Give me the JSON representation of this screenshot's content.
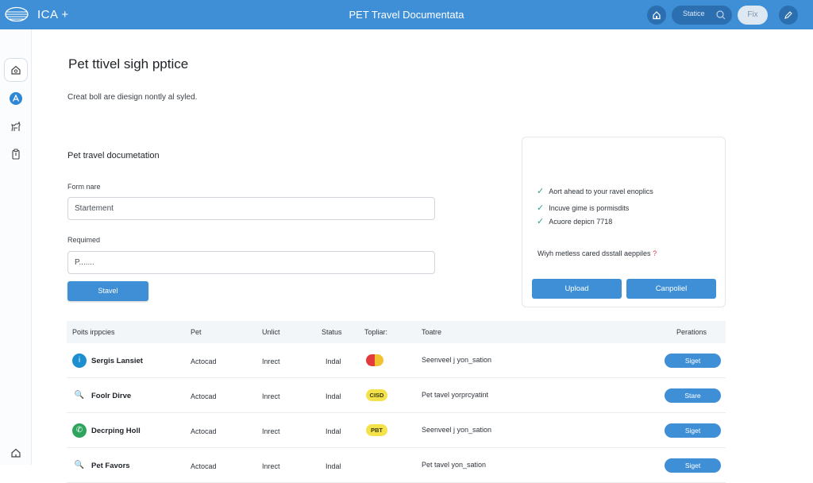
{
  "topbar": {
    "brand": "ICA +",
    "title": "PET Travel Documentata",
    "search_label": "Statice",
    "fix_label": "Fix"
  },
  "page": {
    "title": "Pet ttivel sigh pptice",
    "subtitle": "Creat boll are diesign nontly al syled.",
    "section_title": "Pet travel documetation"
  },
  "form": {
    "field1_label": "Form nare",
    "field1_value": "Startement",
    "field2_label": "Requimed",
    "field2_value": "P.......",
    "save_label": "Stavel"
  },
  "panel": {
    "checks": [
      "Aort ahead to your ravel enoplics",
      "Incuve gime is pormisdits",
      "Acuore depicn 7718"
    ],
    "question": "Wiyh metless cared dsstall aeppiles",
    "question_mark": "?",
    "upload_label": "Upload",
    "cancel_label": "Canpoliel"
  },
  "table": {
    "headers": [
      "Poits irppcies",
      "Pet",
      "Unlict",
      "Status",
      "Topliar:",
      "Toatre",
      "Perations"
    ],
    "rows": [
      {
        "name": "Sergis Lansiet",
        "pet": "Actocad",
        "unlict": "Inrect",
        "status": "Indal",
        "badge": "",
        "toatre": "Seenveel j yon_sation",
        "action": "Siget",
        "icon_color": "#1d8fd0",
        "icon_glyph": "i"
      },
      {
        "name": "Foolr Dirve",
        "pet": "Actocad",
        "unlict": "Inrect",
        "status": "Indal",
        "badge": "CISD",
        "toatre": "Pet tavel yorprcyatint",
        "action": "Stare",
        "icon_color": "#ffffff",
        "icon_glyph": "🔍"
      },
      {
        "name": "Decrping Holl",
        "pet": "Actocad",
        "unlict": "Inrect",
        "status": "Indal",
        "badge": "PBT",
        "toatre": "Seenveel j yon_sation",
        "action": "Siget",
        "icon_color": "#2fa45c",
        "icon_glyph": "✆"
      },
      {
        "name": "Pet Favors",
        "pet": "Actocad",
        "unlict": "Inrect",
        "status": "Indal",
        "badge": "",
        "toatre": "Pet tavel yon_sation",
        "action": "Siget",
        "icon_color": "#ffffff",
        "icon_glyph": "🔍"
      }
    ]
  },
  "colors": {
    "accent": "#3f8fd6",
    "badge_yellow": "#f3e24a"
  }
}
